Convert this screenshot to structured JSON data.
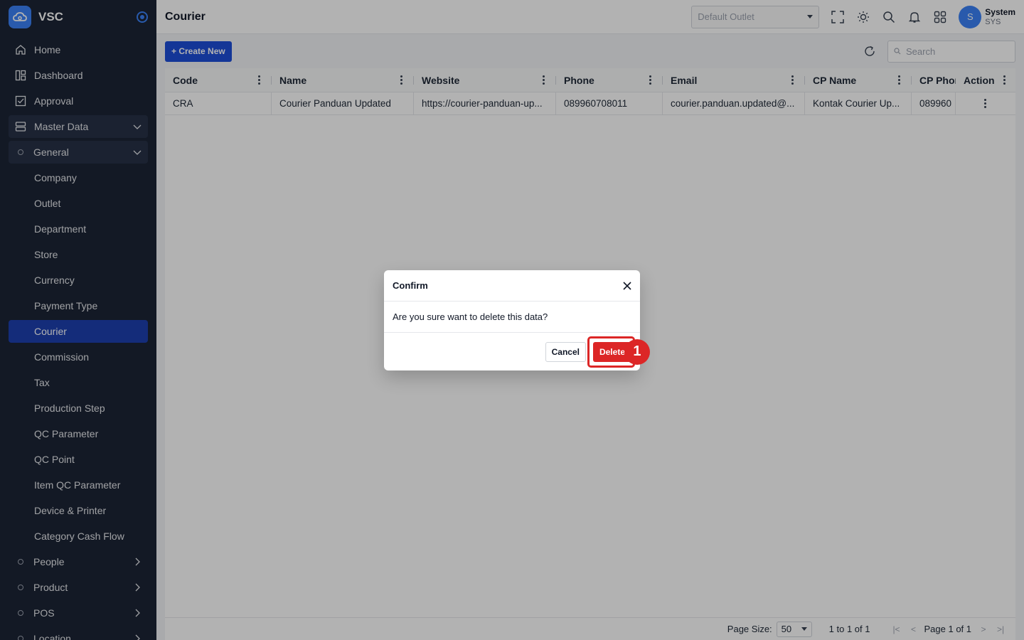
{
  "app": {
    "name": "VSC"
  },
  "sidebar": {
    "items": [
      {
        "label": "Home",
        "icon": "home-icon"
      },
      {
        "label": "Dashboard",
        "icon": "dashboard-icon"
      },
      {
        "label": "Approval",
        "icon": "approval-icon"
      },
      {
        "label": "Master Data",
        "icon": "database-icon"
      },
      {
        "label": "General",
        "icon": "dot"
      },
      {
        "label": "Company"
      },
      {
        "label": "Outlet"
      },
      {
        "label": "Department"
      },
      {
        "label": "Store"
      },
      {
        "label": "Currency"
      },
      {
        "label": "Payment Type"
      },
      {
        "label": "Courier"
      },
      {
        "label": "Commission"
      },
      {
        "label": "Tax"
      },
      {
        "label": "Production Step"
      },
      {
        "label": "QC Parameter"
      },
      {
        "label": "QC Point"
      },
      {
        "label": "Item QC Parameter"
      },
      {
        "label": "Device & Printer"
      },
      {
        "label": "Category Cash Flow"
      },
      {
        "label": "People",
        "icon": "dot"
      },
      {
        "label": "Product",
        "icon": "dot"
      },
      {
        "label": "POS",
        "icon": "dot"
      },
      {
        "label": "Location",
        "icon": "dot"
      }
    ]
  },
  "header": {
    "title": "Courier",
    "outlet_placeholder": "Default Outlet",
    "user_initial": "S",
    "user_name": "System",
    "user_code": "SYS"
  },
  "toolbar": {
    "create_label": "+ Create New",
    "search_placeholder": "Search"
  },
  "table": {
    "columns": [
      "Code",
      "Name",
      "Website",
      "Phone",
      "Email",
      "CP Name",
      "CP Phor",
      "Action"
    ],
    "rows": [
      [
        "CRA",
        "Courier Panduan Updated",
        "https://courier-panduan-up...",
        "089960708011",
        "courier.panduan.updated@...",
        "Kontak Courier Up...",
        "089960"
      ]
    ]
  },
  "footer": {
    "page_size_label": "Page Size:",
    "page_size": "50",
    "range": "1 to 1 of 1",
    "page_text": "Page 1 of 1"
  },
  "modal": {
    "title": "Confirm",
    "message": "Are you sure want to delete this data?",
    "cancel_label": "Cancel",
    "delete_label": "Delete",
    "step_badge": "1"
  },
  "colors": {
    "primary": "#1d4ed8",
    "danger": "#dc2626",
    "sidebar": "#1c2536"
  }
}
